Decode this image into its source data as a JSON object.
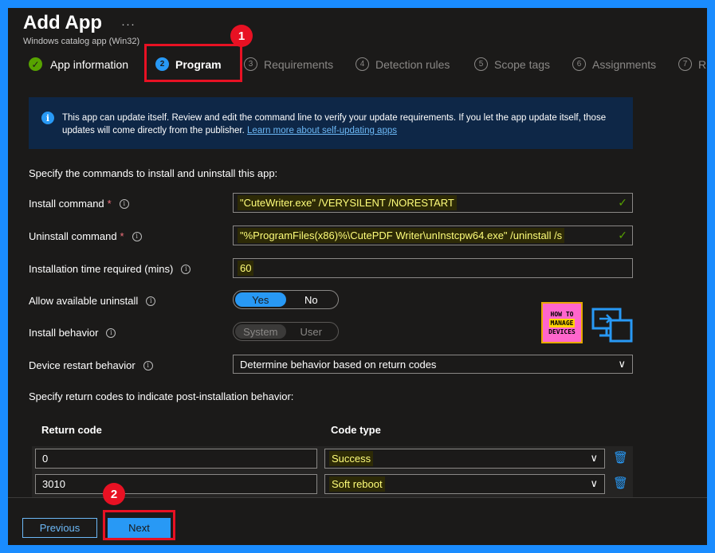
{
  "header": {
    "title": "Add App",
    "more": "···",
    "subtitle": "Windows catalog app (Win32)"
  },
  "steps": [
    {
      "marker": "✓",
      "label": "App information"
    },
    {
      "marker": "2",
      "label": "Program"
    },
    {
      "marker": "3",
      "label": "Requirements"
    },
    {
      "marker": "4",
      "label": "Detection rules"
    },
    {
      "marker": "5",
      "label": "Scope tags"
    },
    {
      "marker": "6",
      "label": "Assignments"
    },
    {
      "marker": "7",
      "label": "R"
    }
  ],
  "annotations": {
    "badge1": "1",
    "badge2": "2"
  },
  "info": {
    "icon": "info-icon",
    "text": "This app can update itself. Review and edit the command line to verify your update requirements. If you let the app update itself, those updates will come directly from the publisher.",
    "link": "Learn more about self-updating apps"
  },
  "form": {
    "intro": "Specify the commands to install and uninstall this app:",
    "install_label": "Install command",
    "install_value": "\"CuteWriter.exe\" /VERYSILENT /NORESTART",
    "uninstall_label": "Uninstall command",
    "uninstall_value": "\"%ProgramFiles(x86)%\\CutePDF Writer\\unInstcpw64.exe\" /uninstall /s",
    "time_label": "Installation time required (mins)",
    "time_value": "60",
    "allow_label": "Allow available uninstall",
    "allow_yes": "Yes",
    "allow_no": "No",
    "behavior_label": "Install behavior",
    "behavior_system": "System",
    "behavior_user": "User",
    "restart_label": "Device restart behavior",
    "restart_value": "Determine behavior based on return codes",
    "required_mark": "*",
    "info_glyph": "i",
    "check_glyph": "✓",
    "chevron_glyph": "∨"
  },
  "return_codes": {
    "intro": "Specify return codes to indicate post-installation behavior:",
    "col_code": "Return code",
    "col_type": "Code type",
    "rows": [
      {
        "code": "0",
        "type": "Success"
      },
      {
        "code": "3010",
        "type": "Soft reboot"
      }
    ]
  },
  "footer": {
    "previous": "Previous",
    "next": "Next"
  },
  "logo": {
    "line1": "HOW TO",
    "line2": "MANAGE",
    "line3": "DEVICES"
  },
  "colors": {
    "accent": "#2899f5",
    "success": "#57a300",
    "annotation": "#e81123",
    "highlight": "#fffe7a"
  }
}
